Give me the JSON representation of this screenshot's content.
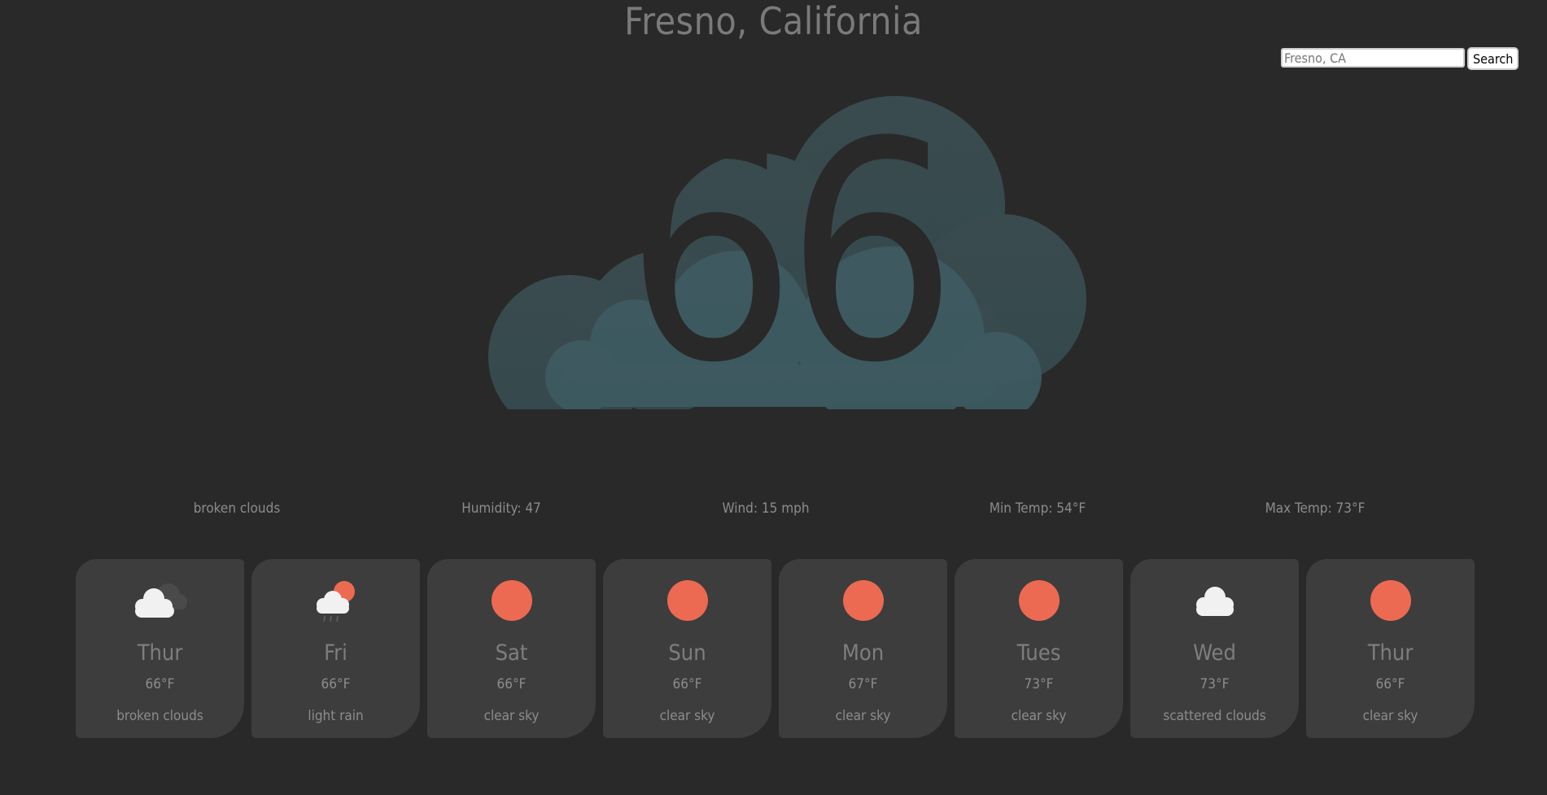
{
  "location": {
    "title": "Fresno, California"
  },
  "search": {
    "placeholder": "Fresno, CA",
    "value": "",
    "button_label": "Search"
  },
  "current": {
    "temp": "66",
    "icon": "cloud-icon",
    "description": "broken clouds",
    "humidity": "Humidity: 47",
    "wind": "Wind: 15 mph",
    "min_temp": "Min Temp: 54°F",
    "max_temp": "Max Temp: 73°F"
  },
  "colors": {
    "background": "#292929",
    "card": "#3d3d3d",
    "sun": "#ec6a52",
    "cloud_hero": "#3e5d63"
  },
  "forecast": [
    {
      "day": "Thur",
      "temp": "66°F",
      "desc": "broken clouds",
      "icon": "broken-clouds-icon"
    },
    {
      "day": "Fri",
      "temp": "66°F",
      "desc": "light rain",
      "icon": "rain-icon"
    },
    {
      "day": "Sat",
      "temp": "66°F",
      "desc": "clear sky",
      "icon": "sun-icon"
    },
    {
      "day": "Sun",
      "temp": "66°F",
      "desc": "clear sky",
      "icon": "sun-icon"
    },
    {
      "day": "Mon",
      "temp": "67°F",
      "desc": "clear sky",
      "icon": "sun-icon"
    },
    {
      "day": "Tues",
      "temp": "73°F",
      "desc": "clear sky",
      "icon": "sun-icon"
    },
    {
      "day": "Wed",
      "temp": "73°F",
      "desc": "scattered clouds",
      "icon": "scattered-clouds-icon"
    },
    {
      "day": "Thur",
      "temp": "66°F",
      "desc": "clear sky",
      "icon": "sun-icon"
    }
  ]
}
